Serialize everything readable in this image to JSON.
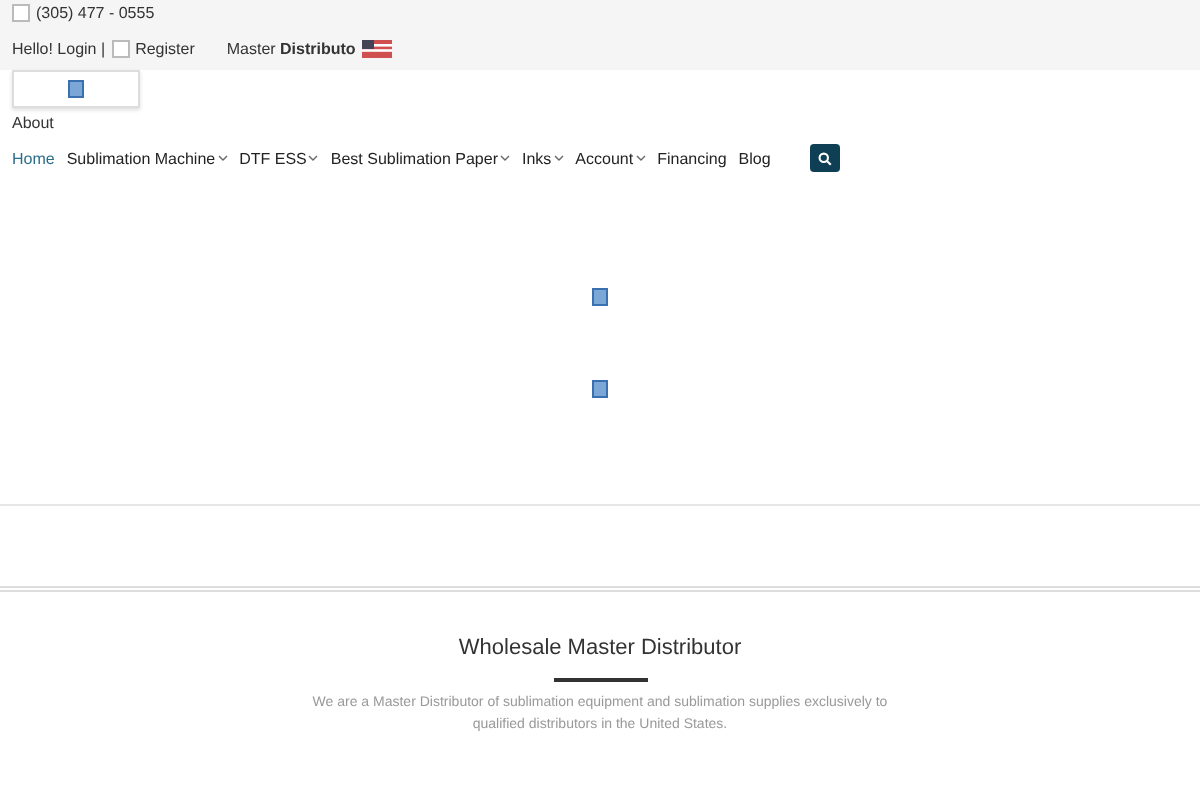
{
  "topbar": {
    "phone": "(305) 477 - 0555",
    "greeting": "Hello! Login |",
    "register": "Register",
    "distributor_prefix": "Master ",
    "distributor_bold": "Distributo"
  },
  "about": "About",
  "nav": [
    {
      "label": "Home",
      "selected": true,
      "dropdown": false
    },
    {
      "label": "Sublimation Machine",
      "selected": false,
      "dropdown": true
    },
    {
      "label": "DTF ESS",
      "selected": false,
      "dropdown": true
    },
    {
      "label": "Best Sublimation Paper",
      "selected": false,
      "dropdown": true
    },
    {
      "label": "Inks",
      "selected": false,
      "dropdown": true
    },
    {
      "label": "Account",
      "selected": false,
      "dropdown": true
    },
    {
      "label": "Financing",
      "selected": false,
      "dropdown": false
    },
    {
      "label": "Blog",
      "selected": false,
      "dropdown": false
    }
  ],
  "section": {
    "title": "Wholesale Master Distributor",
    "text": "We are a Master Distributor of sublimation equipment and sublimation supplies exclusively to qualified distributors in the United States."
  }
}
